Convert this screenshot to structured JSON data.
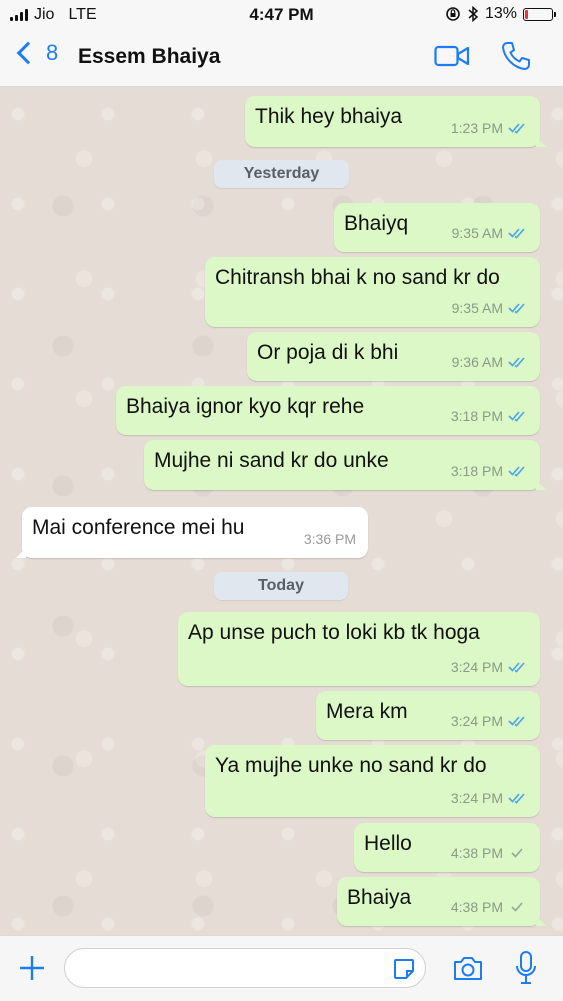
{
  "status_bar": {
    "carrier": "Jio",
    "network": "LTE",
    "time": "4:47 PM",
    "battery": "13%",
    "battery_level": 0.13
  },
  "header": {
    "back_count": "8",
    "contact_name": "Essem Bhaiya",
    "icons": [
      "video-call-icon",
      "phone-call-icon"
    ]
  },
  "colors": {
    "accent": "#1e7cf2",
    "outgoing_bubble": "#dcf8c6",
    "incoming_bubble": "#ffffff",
    "read_ticks": "#4fa6e6",
    "sent_ticks": "#9aa69a"
  },
  "messages": [
    {
      "text": "Thik hey bhaiya",
      "time": "1:23 PM",
      "status": "read"
    },
    {
      "date": "Yesterday"
    },
    {
      "text": "Bhaiyq",
      "time": "9:35 AM",
      "status": "read"
    },
    {
      "text": "Chitransh bhai k no sand kr do",
      "time": "9:35 AM",
      "status": "read"
    },
    {
      "text": "Or poja di k bhi",
      "time": "9:36 AM",
      "status": "read"
    },
    {
      "text": "Bhaiya ignor kyo kqr rehe",
      "time": "3:18 PM",
      "status": "read"
    },
    {
      "text": "Mujhe ni sand kr do unke",
      "time": "3:18 PM",
      "status": "read"
    },
    {
      "text": "Mai conference mei hu",
      "time": "3:36 PM",
      "status": "incoming"
    },
    {
      "date": "Today"
    },
    {
      "text": "Ap unse puch to loki kb tk hoga",
      "time": "3:24 PM",
      "status": "read"
    },
    {
      "text": "Mera km",
      "time": "3:24 PM",
      "status": "read"
    },
    {
      "text": "Ya mujhe unke no sand kr do",
      "time": "3:24 PM",
      "status": "read"
    },
    {
      "text": "Hello",
      "time": "4:38 PM",
      "status": "sent"
    },
    {
      "text": "Bhaiya",
      "time": "4:38 PM",
      "status": "sent"
    }
  ],
  "input_bar": {
    "placeholder": "",
    "icons": [
      "plus-icon",
      "sticker-icon",
      "camera-icon",
      "microphone-icon"
    ]
  }
}
